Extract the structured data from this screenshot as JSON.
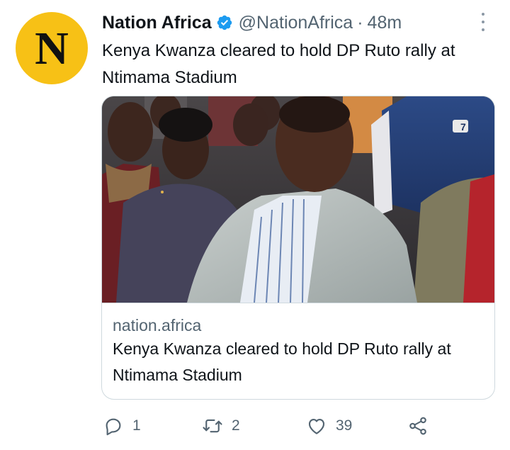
{
  "author": {
    "name": "Nation Africa",
    "handle": "@NationAfrica",
    "separator": "·",
    "time": "48m",
    "avatar_letter": "N",
    "avatar_color": "#f7c116",
    "verified_color": "#1d9bf0"
  },
  "tweet": {
    "text": "Kenya Kwanza cleared to hold DP Ruto rally at Ntimama Stadium"
  },
  "card": {
    "domain": "nation.africa",
    "title": "Kenya Kwanza cleared to hold DP Ruto rally at Ntimama Stadium",
    "image_badge": "7"
  },
  "actions": {
    "reply_count": "1",
    "retweet_count": "2",
    "like_count": "39"
  },
  "icons": [
    "verified-icon",
    "more-icon",
    "reply-icon",
    "retweet-icon",
    "like-icon",
    "share-icon"
  ]
}
